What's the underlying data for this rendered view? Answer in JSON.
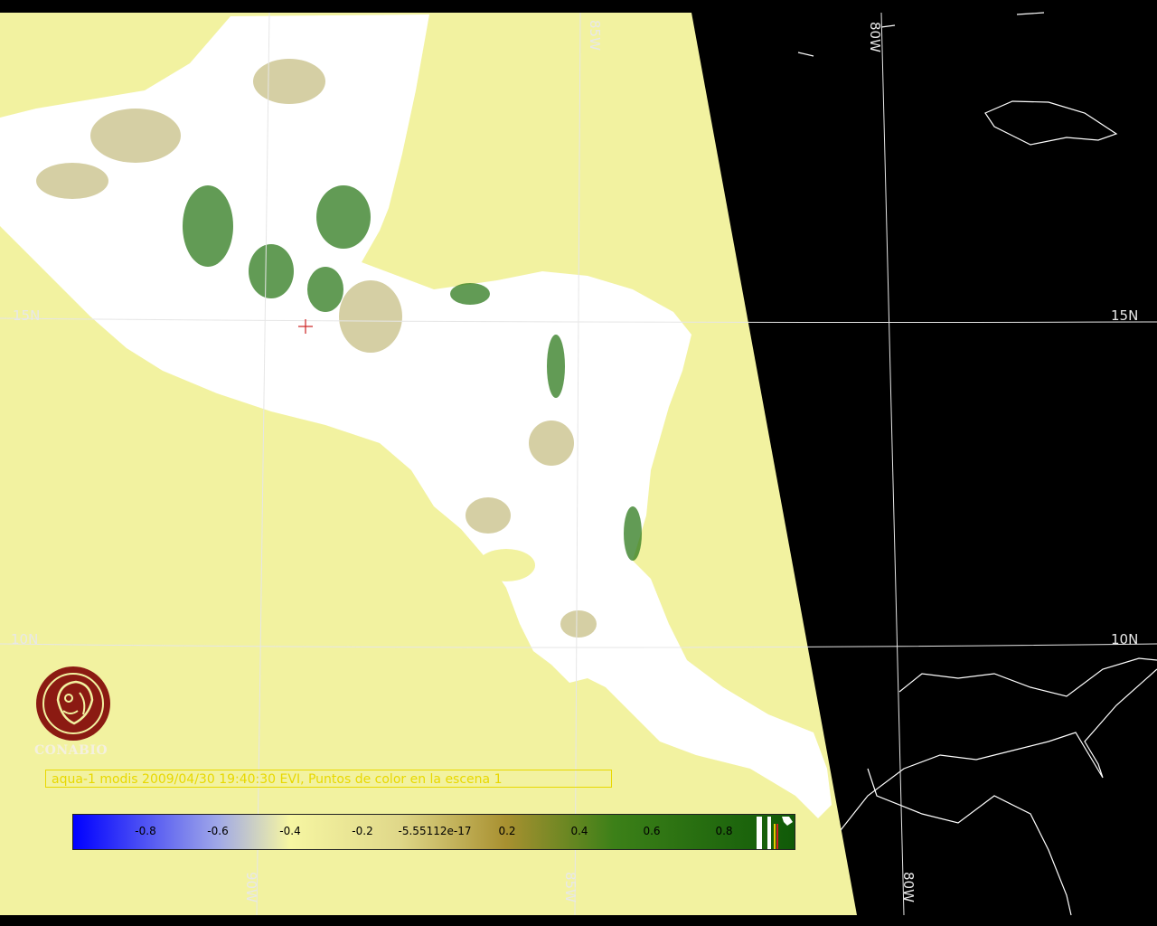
{
  "map": {
    "colors": {
      "background": "#000000",
      "ocean": "#f2f2a0",
      "land_bare": "#ffffff",
      "veg_sparse": "#b3a85a",
      "veg_dense": "#2d7a1c",
      "graticule": "#e6e6e6",
      "coastline": "#ffffff",
      "marker": "#cc2020"
    },
    "graticule_labels": {
      "lon_85w_top": "85W",
      "lon_80w_top": "80W",
      "lat_15n_left": "15N",
      "lat_15n_right": "15N",
      "lat_10n_left": "10N",
      "lat_10n_right": "10N",
      "lon_90w_bottom": "90W",
      "lon_85w_bottom": "85W",
      "lon_80w_bottom": "80W"
    },
    "marker_icon": "crosshair-icon"
  },
  "logo": {
    "icon": "conabio-logo-icon",
    "text": "CONABIO",
    "color": "#8b1a12"
  },
  "caption": {
    "text": "aqua-1 modis 2009/04/30 19:40:30 EVI, Puntos de color en la escena 1",
    "color": "#e8d800"
  },
  "colorbar": {
    "ticks": [
      "-0.8",
      "-0.6",
      "-0.4",
      "-0.2",
      "-5.55112e-17",
      "0.2",
      "0.4",
      "0.6",
      "0.8"
    ],
    "range": [
      -1,
      1
    ],
    "stops": [
      {
        "value": -1.0,
        "color": "#0000ff"
      },
      {
        "value": -0.6,
        "color": "#9fa7e8"
      },
      {
        "value": -0.4,
        "color": "#f6f6a2"
      },
      {
        "value": -0.1,
        "color": "#e0d88a"
      },
      {
        "value": 0.2,
        "color": "#a89030"
      },
      {
        "value": 0.5,
        "color": "#3c8018"
      },
      {
        "value": 1.0,
        "color": "#105a08"
      }
    ]
  }
}
